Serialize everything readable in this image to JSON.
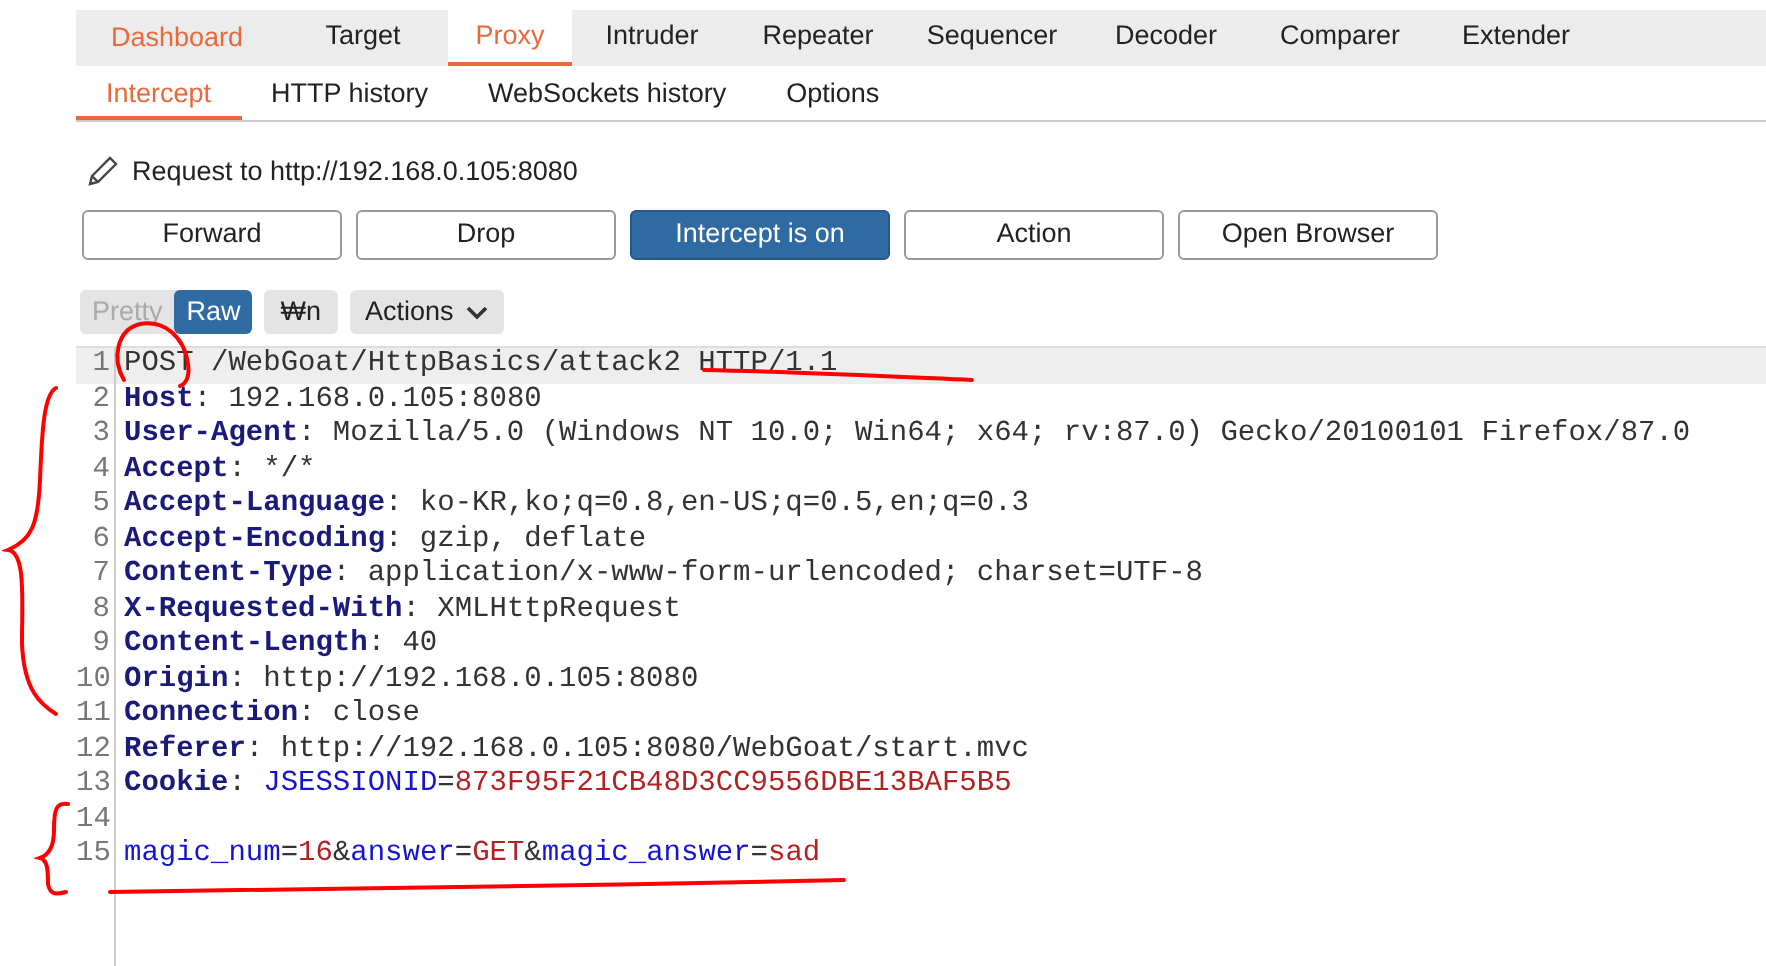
{
  "main_tabs": [
    {
      "label": "Dashboard",
      "selected": false,
      "alert": true
    },
    {
      "label": "Target",
      "selected": false,
      "alert": false
    },
    {
      "label": "Proxy",
      "selected": true,
      "alert": false
    },
    {
      "label": "Intruder",
      "selected": false,
      "alert": false
    },
    {
      "label": "Repeater",
      "selected": false,
      "alert": false
    },
    {
      "label": "Sequencer",
      "selected": false,
      "alert": false
    },
    {
      "label": "Decoder",
      "selected": false,
      "alert": false
    },
    {
      "label": "Comparer",
      "selected": false,
      "alert": false
    },
    {
      "label": "Extender",
      "selected": false,
      "alert": false
    }
  ],
  "sub_tabs": [
    {
      "label": "Intercept",
      "selected": true
    },
    {
      "label": "HTTP history",
      "selected": false
    },
    {
      "label": "WebSockets history",
      "selected": false
    },
    {
      "label": "Options",
      "selected": false
    }
  ],
  "request_label": "Request to http://192.168.0.105:8080",
  "buttons": [
    {
      "label": "Forward",
      "pressed": false
    },
    {
      "label": "Drop",
      "pressed": false
    },
    {
      "label": "Intercept is on",
      "pressed": true
    },
    {
      "label": "Action",
      "pressed": false
    },
    {
      "label": "Open Browser",
      "pressed": false
    }
  ],
  "view_modes": [
    {
      "label": "Pretty",
      "selected": false,
      "disabled": true
    },
    {
      "label": "Raw",
      "selected": true,
      "disabled": false
    }
  ],
  "newline_button": "₩n",
  "actions_menu": "Actions",
  "lines": [
    {
      "number": "1",
      "highlighted": true,
      "segments": [
        {
          "kind": "text",
          "text": "POST /WebGoat/HttpBasics/attack2 HTTP/1.1"
        }
      ]
    },
    {
      "number": "2",
      "highlighted": false,
      "segments": [
        {
          "kind": "key",
          "text": "Host"
        },
        {
          "kind": "text",
          "text": ": 192.168.0.105:8080"
        }
      ]
    },
    {
      "number": "3",
      "highlighted": false,
      "segments": [
        {
          "kind": "key",
          "text": "User-Agent"
        },
        {
          "kind": "text",
          "text": ": Mozilla/5.0 (Windows NT 10.0; Win64; x64; rv:87.0) Gecko/20100101 Firefox/87.0"
        }
      ]
    },
    {
      "number": "4",
      "highlighted": false,
      "segments": [
        {
          "kind": "key",
          "text": "Accept"
        },
        {
          "kind": "text",
          "text": ": */*"
        }
      ]
    },
    {
      "number": "5",
      "highlighted": false,
      "segments": [
        {
          "kind": "key",
          "text": "Accept-Language"
        },
        {
          "kind": "text",
          "text": ": ko-KR,ko;q=0.8,en-US;q=0.5,en;q=0.3"
        }
      ]
    },
    {
      "number": "6",
      "highlighted": false,
      "segments": [
        {
          "kind": "key",
          "text": "Accept-Encoding"
        },
        {
          "kind": "text",
          "text": ": gzip, deflate"
        }
      ]
    },
    {
      "number": "7",
      "highlighted": false,
      "segments": [
        {
          "kind": "key",
          "text": "Content-Type"
        },
        {
          "kind": "text",
          "text": ": application/x-www-form-urlencoded; charset=UTF-8"
        }
      ]
    },
    {
      "number": "8",
      "highlighted": false,
      "segments": [
        {
          "kind": "key",
          "text": "X-Requested-With"
        },
        {
          "kind": "text",
          "text": ": XMLHttpRequest"
        }
      ]
    },
    {
      "number": "9",
      "highlighted": false,
      "segments": [
        {
          "kind": "key",
          "text": "Content-Length"
        },
        {
          "kind": "text",
          "text": ": 40"
        }
      ]
    },
    {
      "number": "10",
      "highlighted": false,
      "segments": [
        {
          "kind": "key",
          "text": "Origin"
        },
        {
          "kind": "text",
          "text": ": http://192.168.0.105:8080"
        }
      ]
    },
    {
      "number": "11",
      "highlighted": false,
      "segments": [
        {
          "kind": "key",
          "text": "Connection"
        },
        {
          "kind": "text",
          "text": ": close"
        }
      ]
    },
    {
      "number": "12",
      "highlighted": false,
      "segments": [
        {
          "kind": "key",
          "text": "Referer"
        },
        {
          "kind": "text",
          "text": ": http://192.168.0.105:8080/WebGoat/start.mvc"
        }
      ]
    },
    {
      "number": "13",
      "highlighted": false,
      "segments": [
        {
          "kind": "key",
          "text": "Cookie"
        },
        {
          "kind": "text",
          "text": ": "
        },
        {
          "kind": "param",
          "text": "JSESSIONID"
        },
        {
          "kind": "text",
          "text": "="
        },
        {
          "kind": "value",
          "text": "873F95F21CB48D3CC9556DBE13BAF5B5"
        }
      ]
    },
    {
      "number": "14",
      "highlighted": false
    },
    {
      "number": "15",
      "highlighted": false,
      "segments": [
        {
          "kind": "param",
          "text": "magic_num"
        },
        {
          "kind": "text",
          "text": "="
        },
        {
          "kind": "value",
          "text": "16"
        },
        {
          "kind": "text",
          "text": "&"
        },
        {
          "kind": "param",
          "text": "answer"
        },
        {
          "kind": "text",
          "text": "="
        },
        {
          "kind": "value",
          "text": "GET"
        },
        {
          "kind": "text",
          "text": "&"
        },
        {
          "kind": "param",
          "text": "magic_answer"
        },
        {
          "kind": "text",
          "text": "="
        },
        {
          "kind": "value",
          "text": "sad"
        }
      ]
    }
  ],
  "pen_marks": [
    {
      "kind": "circle"
    },
    {
      "kind": "underline"
    },
    {
      "kind": "brace"
    },
    {
      "kind": "brace"
    },
    {
      "kind": "underline"
    }
  ]
}
